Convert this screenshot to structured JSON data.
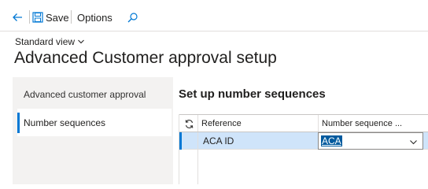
{
  "toolbar": {
    "save_label": "Save",
    "options_label": "Options"
  },
  "header": {
    "view_label": "Standard view",
    "title": "Advanced Customer approval setup"
  },
  "nav": {
    "items": [
      {
        "label": "Advanced customer approval",
        "active": false
      },
      {
        "label": "Number sequences",
        "active": true
      }
    ]
  },
  "main": {
    "section_title": "Set up number sequences",
    "grid": {
      "columns": [
        "Reference",
        "Number sequence ..."
      ],
      "rows": [
        {
          "reference": "ACA ID",
          "number_sequence": "ACA"
        }
      ]
    }
  },
  "colors": {
    "accent": "#0078d4",
    "selected_row": "#cfe4fa",
    "nav_background": "#f3f2f1"
  },
  "icons": [
    "back-arrow-icon",
    "save-icon",
    "search-icon",
    "chevron-down-icon",
    "refresh-icon"
  ]
}
